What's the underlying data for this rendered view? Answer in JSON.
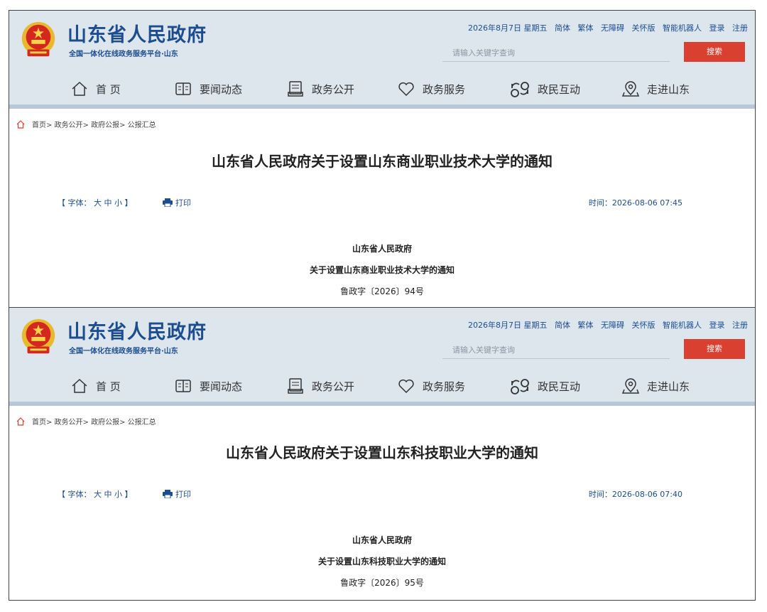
{
  "colors": {
    "brand": "#1c4e8f",
    "header_bg": "#dde5ed",
    "search_button": "#d9402f",
    "nav_bar": "#b8c8d8"
  },
  "pages": [
    {
      "site_name": "山东省人民政府",
      "site_sub": "全国一体化在线政务服务平台·山东",
      "toplinks": {
        "date": "2026年8月7日 星期五",
        "simplified": "简体",
        "traditional": "繁体",
        "accessibility": "无障碍",
        "care": "关怀版",
        "robot": "智能机器人",
        "login": "登录",
        "register": "注册"
      },
      "search": {
        "placeholder": "请输入关键字查询",
        "button": "搜索"
      },
      "nav": [
        {
          "label": "首 页",
          "icon": "home-icon"
        },
        {
          "label": "要闻动态",
          "icon": "book-icon"
        },
        {
          "label": "政务公开",
          "icon": "document-icon"
        },
        {
          "label": "政务服务",
          "icon": "heart-icon"
        },
        {
          "label": "政民互动",
          "icon": "interaction-icon"
        },
        {
          "label": "走进山东",
          "icon": "location-icon"
        }
      ],
      "breadcrumb": "首页> 政务公开> 政府公报> 公报汇总",
      "title": "山东省人民政府关于设置山东商业职业技术大学的通知",
      "font_size_label": "【 字体： 大 中 小 】",
      "print_label": "打印",
      "time": "时间：2026-08-06 07:45",
      "doc_issuer": "山东省人民政府",
      "doc_title": "关于设置山东商业职业技术大学的通知",
      "doc_number": "鲁政字〔2026〕94号"
    },
    {
      "site_name": "山东省人民政府",
      "site_sub": "全国一体化在线政务服务平台·山东",
      "toplinks": {
        "date": "2026年8月7日 星期五",
        "simplified": "简体",
        "traditional": "繁体",
        "accessibility": "无障碍",
        "care": "关怀版",
        "robot": "智能机器人",
        "login": "登录",
        "register": "注册"
      },
      "search": {
        "placeholder": "请输入关键字查询",
        "button": "搜索"
      },
      "nav": [
        {
          "label": "首 页",
          "icon": "home-icon"
        },
        {
          "label": "要闻动态",
          "icon": "book-icon"
        },
        {
          "label": "政务公开",
          "icon": "document-icon"
        },
        {
          "label": "政务服务",
          "icon": "heart-icon"
        },
        {
          "label": "政民互动",
          "icon": "interaction-icon"
        },
        {
          "label": "走进山东",
          "icon": "location-icon"
        }
      ],
      "breadcrumb": "首页> 政务公开> 政府公报> 公报汇总",
      "title": "山东省人民政府关于设置山东科技职业大学的通知",
      "font_size_label": "【 字体： 大 中 小 】",
      "print_label": "打印",
      "time": "时间：2026-08-06 07:40",
      "doc_issuer": "山东省人民政府",
      "doc_title": "关于设置山东科技职业大学的通知",
      "doc_number": "鲁政字〔2026〕95号"
    }
  ]
}
